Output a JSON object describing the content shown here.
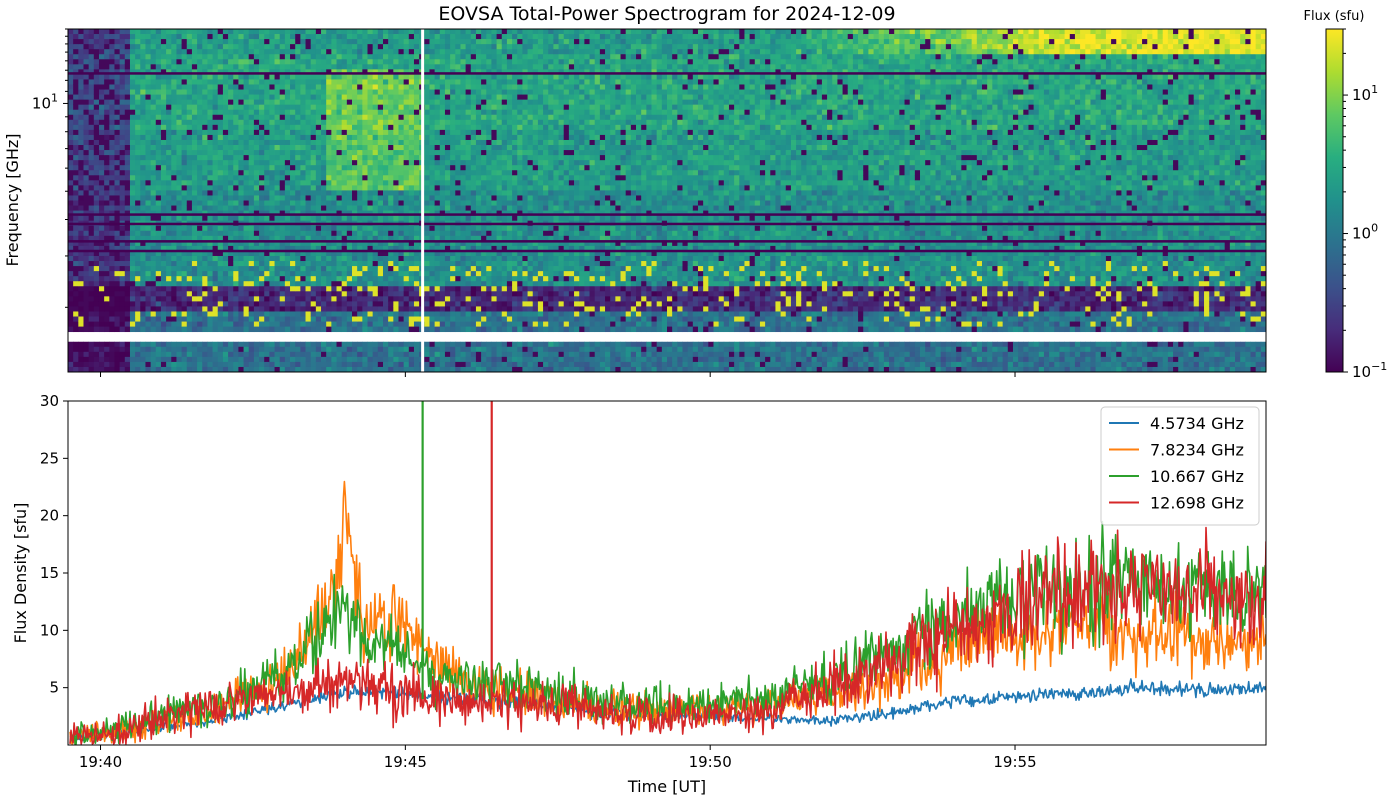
{
  "chart_data": [
    {
      "type": "heatmap",
      "title": "EOVSA Total-Power Spectrogram for 2024-12-09",
      "xlabel": "",
      "ylabel": "Frequency [GHz]",
      "y_scale": "log",
      "y_ticks": [
        {
          "value": 10,
          "base": "10",
          "exp": "1"
        }
      ],
      "x_ticks": [
        "19:40",
        "19:45",
        "19:50",
        "19:55"
      ],
      "xlim": [
        "19:39:28",
        "19:59:07"
      ],
      "ylim_ghz": [
        1.2,
        18.0
      ],
      "colorbar": {
        "label": "Flux (sfu)",
        "scale": "log",
        "colormap": "viridis",
        "range": [
          0.1,
          30
        ],
        "ticks": [
          {
            "base": "10",
            "exp": "−1",
            "value": 0.1
          },
          {
            "base": "10",
            "exp": "0",
            "value": 1
          },
          {
            "base": "10",
            "exp": "1",
            "value": 10
          }
        ]
      },
      "features": {
        "data_start": "19:39:28",
        "data_gap_time": "19:45:17",
        "frequency_gap_ghz": [
          1.5,
          1.67
        ],
        "bright_burst_center": "19:44:30"
      }
    },
    {
      "type": "line",
      "xlabel": "Time [UT]",
      "ylabel": "Flux Density [sfu]",
      "ylim": [
        0,
        30
      ],
      "y_ticks": [
        5,
        10,
        15,
        20,
        25,
        30
      ],
      "x_ticks": [
        "19:40",
        "19:45",
        "19:50",
        "19:55"
      ],
      "xlim": [
        "19:39:28",
        "19:59:07"
      ],
      "legend_position": "top-right",
      "series": [
        {
          "name": "4.5734 GHz",
          "color": "#1f77b4",
          "times": [
            "19:39:30",
            "19:40:00",
            "19:41:00",
            "19:42:00",
            "19:43:00",
            "19:43:30",
            "19:44:00",
            "19:44:30",
            "19:45:00",
            "19:45:30",
            "19:46:00",
            "19:47:00",
            "19:48:00",
            "19:49:00",
            "19:50:00",
            "19:51:00",
            "19:52:00",
            "19:53:00",
            "19:54:00",
            "19:55:00",
            "19:56:00",
            "19:57:00",
            "19:58:00",
            "19:59:00"
          ],
          "values": [
            0.5,
            0.8,
            1.5,
            2.2,
            3.5,
            4.0,
            4.5,
            4.8,
            4.5,
            4.2,
            4.0,
            3.6,
            3.0,
            2.6,
            2.5,
            2.3,
            2.1,
            2.8,
            3.8,
            4.2,
            4.5,
            5.0,
            4.8,
            5.0
          ]
        },
        {
          "name": "7.8234 GHz",
          "color": "#ff7f0e",
          "times": [
            "19:39:30",
            "19:40:00",
            "19:41:00",
            "19:42:00",
            "19:43:00",
            "19:43:30",
            "19:43:50",
            "19:44:00",
            "19:44:20",
            "19:44:50",
            "19:45:00",
            "19:45:30",
            "19:46:00",
            "19:47:00",
            "19:48:00",
            "19:49:00",
            "19:50:00",
            "19:51:00",
            "19:52:00",
            "19:53:00",
            "19:54:00",
            "19:55:00",
            "19:56:00",
            "19:57:00",
            "19:58:00",
            "19:59:00"
          ],
          "values": [
            0.8,
            1.0,
            2.0,
            3.5,
            5.5,
            10.0,
            14.0,
            21.0,
            10.0,
            11.5,
            10.0,
            7.0,
            5.5,
            4.5,
            3.5,
            3.0,
            3.0,
            3.5,
            4.5,
            6.0,
            8.5,
            9.5,
            10.5,
            10.0,
            9.0,
            8.5
          ]
        },
        {
          "name": "10.667 GHz",
          "color": "#2ca02c",
          "times": [
            "19:39:30",
            "19:40:00",
            "19:41:00",
            "19:42:00",
            "19:43:00",
            "19:43:30",
            "19:44:00",
            "19:44:30",
            "19:45:00",
            "19:45:30",
            "19:46:00",
            "19:47:00",
            "19:48:00",
            "19:49:00",
            "19:50:00",
            "19:51:00",
            "19:52:00",
            "19:53:00",
            "19:54:00",
            "19:55:00",
            "19:56:00",
            "19:57:00",
            "19:58:00",
            "19:59:00"
          ],
          "values": [
            0.8,
            1.0,
            2.5,
            4.0,
            6.0,
            9.0,
            12.0,
            8.5,
            8.0,
            6.0,
            5.5,
            5.0,
            4.0,
            3.5,
            3.5,
            4.0,
            6.0,
            8.5,
            11.0,
            13.0,
            14.0,
            14.5,
            13.5,
            12.5
          ]
        },
        {
          "name": "12.698 GHz",
          "color": "#d62728",
          "times": [
            "19:39:30",
            "19:40:00",
            "19:41:00",
            "19:42:00",
            "19:43:00",
            "19:43:30",
            "19:44:00",
            "19:44:30",
            "19:45:00",
            "19:45:30",
            "19:46:00",
            "19:47:00",
            "19:48:00",
            "19:49:00",
            "19:50:00",
            "19:51:00",
            "19:52:00",
            "19:53:00",
            "19:54:00",
            "19:55:00",
            "19:56:00",
            "19:57:00",
            "19:58:00",
            "19:59:00"
          ],
          "values": [
            0.5,
            0.8,
            2.5,
            3.5,
            4.5,
            5.0,
            5.5,
            5.0,
            4.5,
            4.0,
            4.0,
            3.5,
            3.0,
            2.5,
            2.5,
            3.0,
            5.0,
            7.5,
            10.0,
            12.0,
            13.5,
            14.0,
            13.0,
            12.5
          ]
        }
      ],
      "spikes": [
        {
          "series": "10.667 GHz",
          "time": "19:45:17",
          "value_min": 30
        },
        {
          "series": "12.698 GHz",
          "time": "19:46:25",
          "value_min": 30
        }
      ]
    }
  ]
}
